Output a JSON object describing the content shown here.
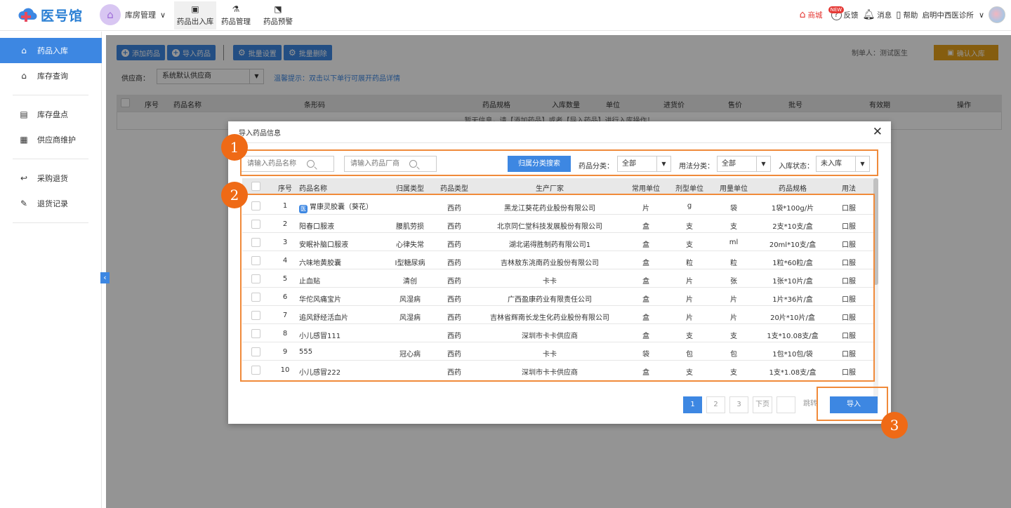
{
  "brand": {
    "name": "医号馆",
    "color": "#2a7fd4"
  },
  "accent": "#3d87e2",
  "header": {
    "store_menu": "库房管理",
    "nav": [
      {
        "label": "药品出入库",
        "icon": "box-in-icon"
      },
      {
        "label": "药品管理",
        "icon": "flask-icon"
      },
      {
        "label": "药品预警",
        "icon": "warning-icon"
      }
    ],
    "tools": {
      "mall": "商城",
      "mall_badge": "NEW",
      "feedback": "反馈",
      "message": "消息",
      "help": "帮助",
      "clinic": "启明中西医诊所"
    }
  },
  "sidebar": {
    "items": [
      {
        "label": "药品入库",
        "icon": "home-in-icon",
        "active": true
      },
      {
        "label": "库存查询",
        "icon": "home-search-icon"
      },
      {
        "label": "库存盘点",
        "icon": "inventory-icon"
      },
      {
        "label": "供应商维护",
        "icon": "supplier-icon"
      },
      {
        "label": "采购退货",
        "icon": "return-icon"
      },
      {
        "label": "退货记录",
        "icon": "record-icon"
      }
    ]
  },
  "main": {
    "buttons": {
      "add": "添加药品",
      "import": "导入药品",
      "batch_set": "批量设置",
      "batch_delete": "批量删除",
      "confirm": "确认入库"
    },
    "maker": "制单人：测试医生",
    "supplier_label": "供应商：",
    "supplier_value": "系统默认供应商",
    "tip": "温馨提示：双击以下单行可展开药品详情",
    "columns": [
      "序号",
      "药品名称",
      "条形码",
      "药品规格",
      "入库数量",
      "单位",
      "进货价",
      "售价",
      "批号",
      "有效期",
      "操作"
    ],
    "empty_text": "暂无信息，请【添加药品】或者【导入药品】进行入库操作！"
  },
  "modal": {
    "title": "导入药品信息",
    "search_name_placeholder": "请输入药品名称",
    "search_vendor_placeholder": "请输入药品厂商",
    "category_search_button": "归属分类搜索",
    "filters": [
      {
        "label": "药品分类：",
        "value": "全部"
      },
      {
        "label": "用法分类：",
        "value": "全部"
      },
      {
        "label": "入库状态：",
        "value": "未入库"
      }
    ],
    "columns": [
      "序号",
      "药品名称",
      "归属类型",
      "药品类型",
      "生产厂家",
      "常用单位",
      "剂型单位",
      "用量单位",
      "药品规格",
      "用法"
    ],
    "rows": [
      {
        "no": "1",
        "name": "胃康灵胶囊（葵花）",
        "badge": "医",
        "category": "",
        "type": "西药",
        "maker": "黑龙江葵花药业股份有限公司",
        "unit": "片",
        "dose_unit": "g",
        "use_unit": "袋",
        "spec": "1袋*100g/片",
        "usage": "口服"
      },
      {
        "no": "2",
        "name": "阳春口服液",
        "category": "腰肌劳损",
        "type": "西药",
        "maker": "北京同仁堂科技发展股份有限公司",
        "unit": "盒",
        "dose_unit": "支",
        "use_unit": "支",
        "spec": "2支*10支/盒",
        "usage": "口服"
      },
      {
        "no": "3",
        "name": "安眠补脑口服液",
        "category": "心律失常",
        "type": "西药",
        "maker": "湖北诺得胜制药有限公司1",
        "unit": "盒",
        "dose_unit": "支",
        "use_unit": "ml",
        "spec": "20ml*10支/盒",
        "usage": "口服"
      },
      {
        "no": "4",
        "name": "六味地黄胶囊",
        "category": "I型糖尿病",
        "type": "西药",
        "maker": "吉林敖东洮南药业股份有限公司",
        "unit": "盒",
        "dose_unit": "粒",
        "use_unit": "粒",
        "spec": "1粒*60粒/盒",
        "usage": "口服"
      },
      {
        "no": "5",
        "name": "止血贴",
        "category": "清创",
        "type": "西药",
        "maker": "卡卡",
        "unit": "盒",
        "dose_unit": "片",
        "use_unit": "张",
        "spec": "1张*10片/盒",
        "usage": "口服"
      },
      {
        "no": "6",
        "name": "华佗风痛宝片",
        "category": "风湿病",
        "type": "西药",
        "maker": "广西盈康药业有限责任公司",
        "unit": "盒",
        "dose_unit": "片",
        "use_unit": "片",
        "spec": "1片*36片/盒",
        "usage": "口服"
      },
      {
        "no": "7",
        "name": "追风舒经活血片",
        "category": "风湿病",
        "type": "西药",
        "maker": "吉林省辉南长龙生化药业股份有限公司",
        "unit": "盒",
        "dose_unit": "片",
        "use_unit": "片",
        "spec": "20片*10片/盒",
        "usage": "口服"
      },
      {
        "no": "8",
        "name": "小儿感冒111",
        "category": "",
        "type": "西药",
        "maker": "深圳市卡卡供应商",
        "unit": "盒",
        "dose_unit": "支",
        "use_unit": "支",
        "spec": "1支*10.08支/盒",
        "usage": "口服"
      },
      {
        "no": "9",
        "name": "555",
        "category": "冠心病",
        "type": "西药",
        "maker": "卡卡",
        "unit": "袋",
        "dose_unit": "包",
        "use_unit": "包",
        "spec": "1包*10包/袋",
        "usage": "口服"
      },
      {
        "no": "10",
        "name": "小儿感冒222",
        "category": "",
        "type": "西药",
        "maker": "深圳市卡卡供应商",
        "unit": "盒",
        "dose_unit": "支",
        "use_unit": "支",
        "spec": "1支*1.08支/盒",
        "usage": "口服"
      }
    ],
    "pagination": {
      "pages": [
        "1",
        "2",
        "3"
      ],
      "current": "1",
      "next": "下页",
      "jump": "跳转"
    },
    "import_button": "导入"
  },
  "annotations": [
    "1",
    "2",
    "3"
  ],
  "annotation_color": "#ef6a16"
}
